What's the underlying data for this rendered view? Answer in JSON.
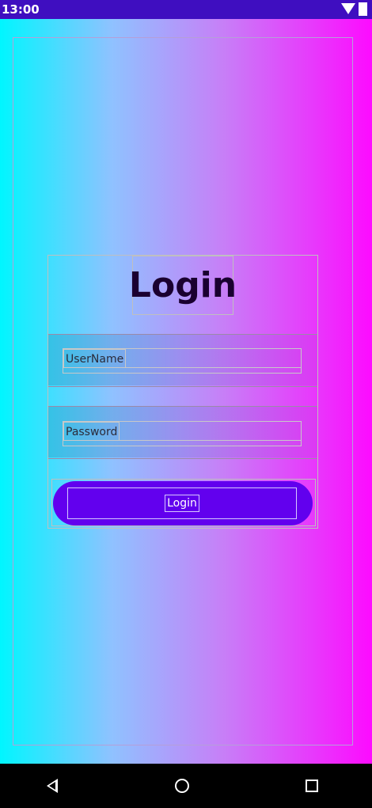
{
  "status_bar": {
    "time": "13:00",
    "icons": [
      "wifi-icon",
      "battery-icon"
    ]
  },
  "login_form": {
    "title": "Login",
    "username_placeholder": "UserName",
    "password_placeholder": "Password",
    "login_button_label": "Login"
  },
  "nav_bar": {
    "icons": [
      "back-icon",
      "home-icon",
      "recents-icon"
    ]
  },
  "colors": {
    "gradient_start": "#00f6ff",
    "gradient_end": "#fd0bff",
    "button": "#6200ee",
    "status_bar": "#3f0ec0"
  }
}
